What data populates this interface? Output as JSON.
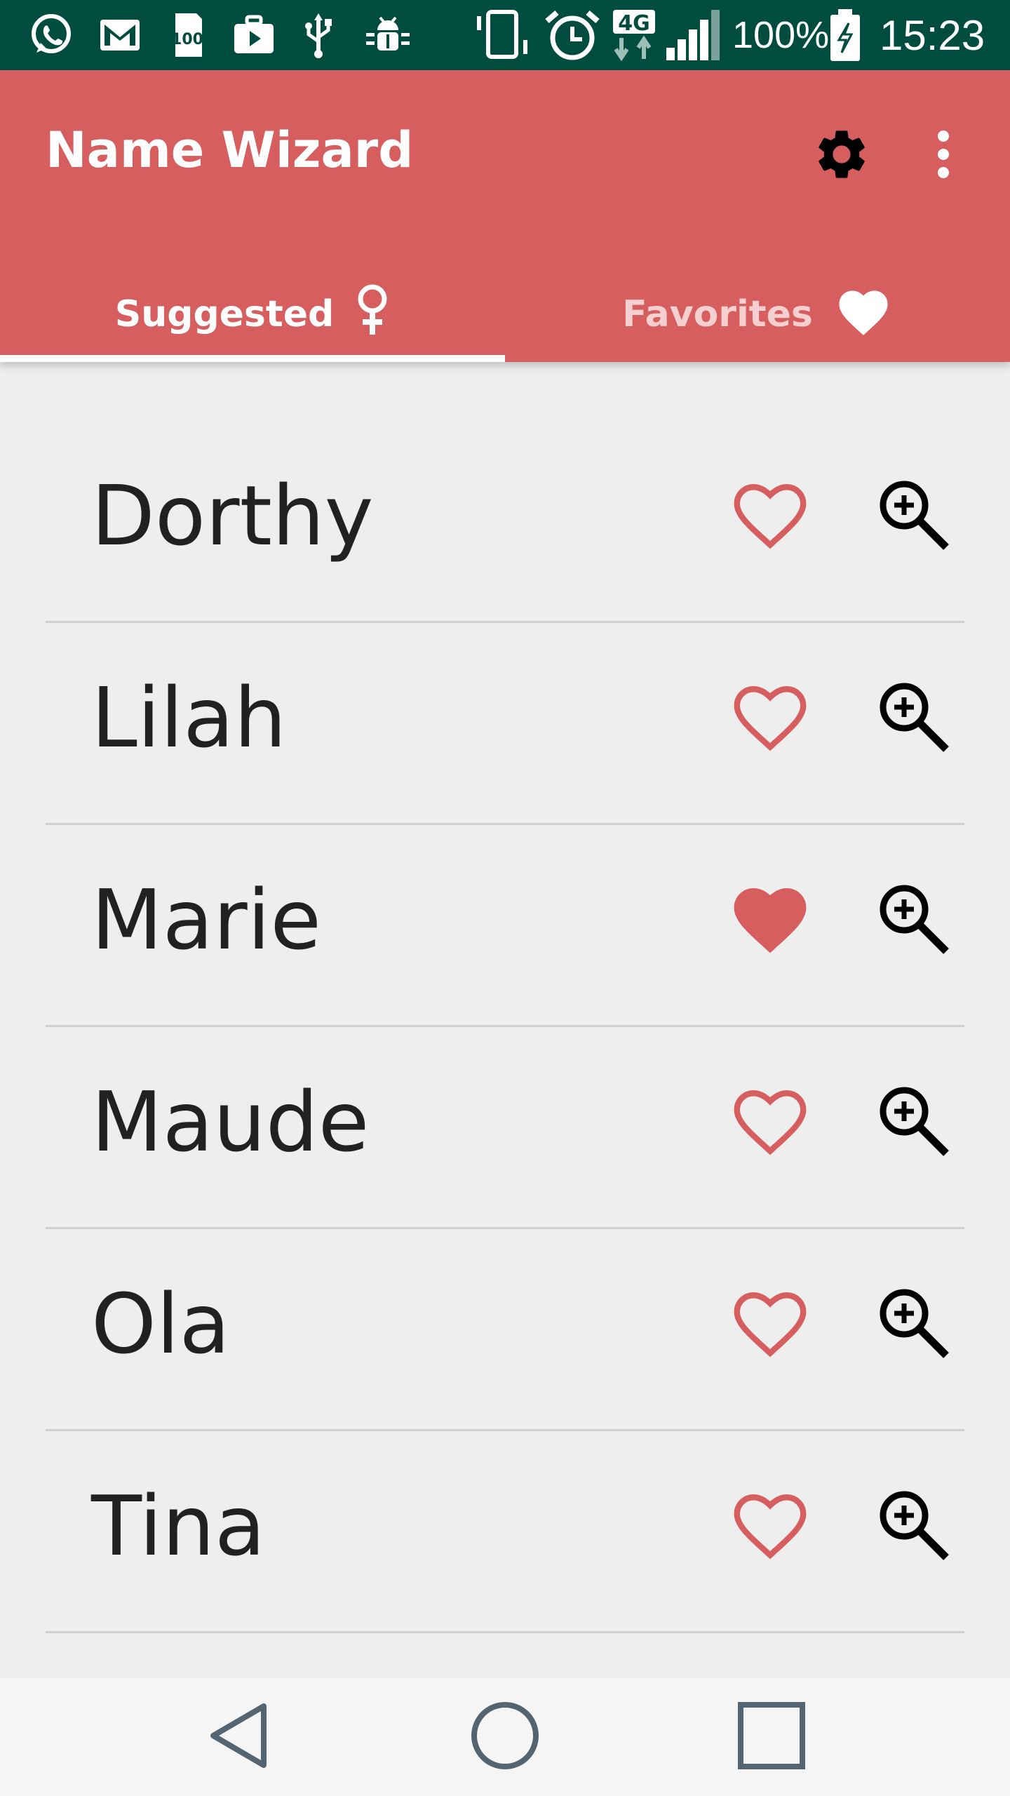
{
  "status_bar": {
    "battery_percent": "100%",
    "time": "15:23",
    "network": "4G",
    "icons": [
      "whatsapp-icon",
      "gmail-icon",
      "storage-icon",
      "briefcase-play-icon",
      "usb-icon",
      "android-debug-icon",
      "vibrate-icon",
      "alarm-icon",
      "4g-data-icon",
      "signal-icon",
      "battery-charging-icon"
    ]
  },
  "app_bar": {
    "title": "Name Wizard",
    "settings_icon": "gear-icon",
    "overflow_icon": "more-vert-icon",
    "tabs": [
      {
        "label": "Suggested",
        "icon": "female-symbol-icon",
        "selected": true
      },
      {
        "label": "Favorites",
        "icon": "heart-icon",
        "selected": false
      }
    ]
  },
  "names": [
    {
      "name": "Dorthy",
      "favorite": false
    },
    {
      "name": "Lilah",
      "favorite": false
    },
    {
      "name": "Marie",
      "favorite": true
    },
    {
      "name": "Maude",
      "favorite": false
    },
    {
      "name": "Ola",
      "favorite": false
    },
    {
      "name": "Tina",
      "favorite": false
    }
  ],
  "nav_bar": {
    "buttons": [
      "back-icon",
      "home-icon",
      "recents-icon"
    ]
  },
  "colors": {
    "status_bar": "#004d40",
    "primary": "#d75e5e",
    "background": "#eeeeee",
    "heart": "#d75e5e",
    "tab_inactive": "#f6d0d0"
  }
}
